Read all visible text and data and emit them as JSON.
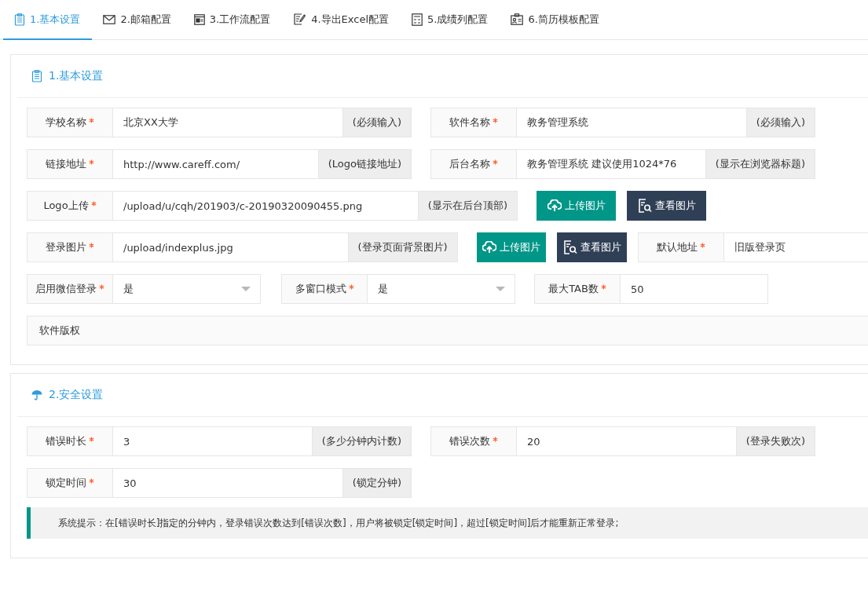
{
  "tabs": [
    {
      "label": "1.基本设置",
      "selected": true
    },
    {
      "label": "2.邮箱配置",
      "selected": false
    },
    {
      "label": "3.工作流配置",
      "selected": false
    },
    {
      "label": "4.导出Excel配置",
      "selected": false
    },
    {
      "label": "5.成绩列配置",
      "selected": false
    },
    {
      "label": "6.简历模板配置",
      "selected": false
    }
  ],
  "sections": [
    {
      "title": "1.基本设置",
      "rows": [
        {
          "kind": "pair",
          "fields": [
            {
              "label": "学校名称",
              "required": true,
              "value": "北京XX大学",
              "addon": "(必须输入)"
            },
            {
              "label": "软件名称",
              "required": true,
              "value": "教务管理系统",
              "addon": "(必须输入)"
            }
          ]
        },
        {
          "kind": "pair",
          "fields": [
            {
              "label": "链接地址",
              "required": true,
              "value": "http://www.careff.com/",
              "addon": "(Logo链接地址)"
            },
            {
              "label": "后台名称",
              "required": true,
              "value": "教务管理系统 建议使用1024*76",
              "addon": "(显示在浏览器标题)"
            }
          ]
        },
        {
          "kind": "upload",
          "fields": [
            {
              "label": "Logo上传",
              "required": true,
              "value": "/upload/u/cqh/201903/c-20190320090455.png",
              "addon": "(显示在后台顶部)"
            }
          ],
          "buttons": [
            {
              "kind": "upload",
              "label": "上传图片"
            },
            {
              "kind": "view",
              "label": "查看图片"
            }
          ]
        },
        {
          "kind": "upload",
          "fields": [
            {
              "label": "登录图片",
              "required": true,
              "value": "/upload/indexplus.jpg",
              "addon": "(登录页面背景图片)"
            },
            {
              "label": "默认地址",
              "required": true,
              "value": "旧版登录页"
            }
          ],
          "buttons": [
            {
              "kind": "upload",
              "label": "上传图片"
            },
            {
              "kind": "view",
              "label": "查看图片"
            }
          ]
        },
        {
          "kind": "triple",
          "fields": [
            {
              "kind": "select",
              "label": "启用微信登录",
              "required": true,
              "value": "是"
            },
            {
              "kind": "select",
              "label": "多窗口模式",
              "required": true,
              "value": "是"
            },
            {
              "kind": "text",
              "label": "最大TAB数",
              "required": true,
              "value": "50"
            }
          ]
        },
        {
          "kind": "full",
          "fields": [
            {
              "label": "软件版权",
              "required": false
            }
          ]
        }
      ]
    },
    {
      "title": "2.安全设置",
      "rows": [
        {
          "kind": "pair",
          "fields": [
            {
              "label": "错误时长",
              "required": true,
              "value": "3",
              "addon": "(多少分钟内计数)"
            },
            {
              "label": "错误次数",
              "required": true,
              "value": "20",
              "addon": "(登录失败次)"
            }
          ]
        },
        {
          "kind": "pair",
          "fields": [
            {
              "label": "锁定时间",
              "required": true,
              "value": "30",
              "addon": "(锁定分钟)"
            }
          ]
        }
      ],
      "tip": "系统提示：在[错误时长]指定的分钟内，登录错误次数达到[错误次数]，用户将被锁定[锁定时间]，超过[锁定时间]后才能重新正常登录;"
    }
  ]
}
